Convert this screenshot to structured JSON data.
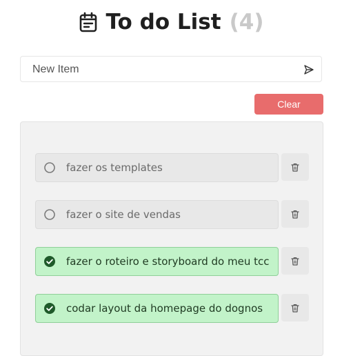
{
  "header": {
    "title": "To do List",
    "count": "(4)",
    "icon": "calendar-icon"
  },
  "new_item": {
    "placeholder": "New Item",
    "value": "",
    "send_icon": "send-icon"
  },
  "clear_label": "Clear",
  "colors": {
    "clear_button": "#e86c6c",
    "done_background": "#c2f3c9",
    "done_check": "#1f5a2a",
    "count_text": "#c9c9c9"
  },
  "todos": [
    {
      "text": "fazer os templates",
      "done": false
    },
    {
      "text": "fazer o site de vendas",
      "done": false
    },
    {
      "text": "fazer o roteiro e storyboard do meu tcc",
      "done": true
    },
    {
      "text": "codar layout da homepage do dognos",
      "done": true
    }
  ],
  "delete_icon": "trash-icon"
}
